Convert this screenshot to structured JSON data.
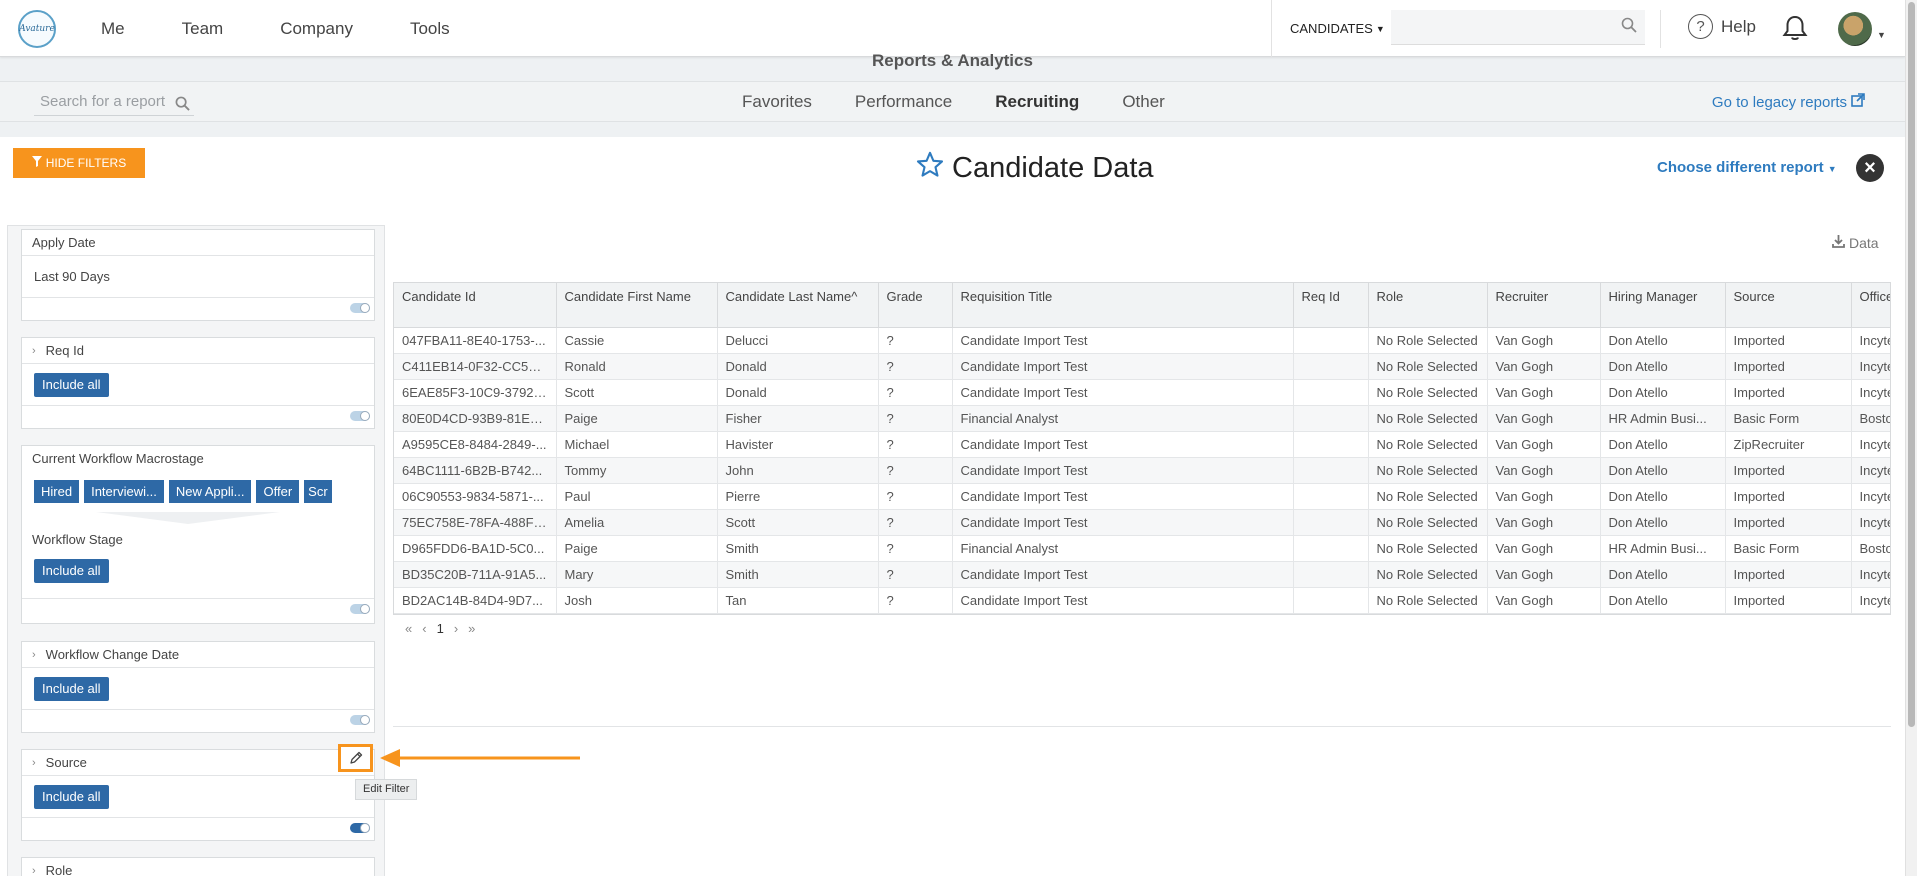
{
  "topnav": {
    "logo_text": "Avature",
    "links": [
      "Me",
      "Team",
      "Company",
      "Tools"
    ],
    "candidates_label": "CANDIDATES",
    "help_label": "Help"
  },
  "reports": {
    "title": "Reports & Analytics",
    "search_placeholder": "Search for a report",
    "tabs": [
      "Favorites",
      "Performance",
      "Recruiting",
      "Other"
    ],
    "active_tab": "Recruiting",
    "legacy_label": "Go to legacy reports"
  },
  "report": {
    "hide_filters_label": "HIDE FILTERS",
    "title": "Candidate Data",
    "choose_label": "Choose different report",
    "export_label": "Data"
  },
  "filters": {
    "apply_date": {
      "label": "Apply Date",
      "value": "Last 90 Days"
    },
    "req_id": {
      "label": "Req Id",
      "button": "Include all"
    },
    "macrostage": {
      "label": "Current Workflow Macrostage",
      "chips": [
        "Hired",
        "Interviewi...",
        "New Appli...",
        "Offer",
        "Scr"
      ],
      "stage_label": "Workflow Stage",
      "stage_button": "Include all"
    },
    "workflow_change_date": {
      "label": "Workflow Change Date",
      "button": "Include all"
    },
    "source": {
      "label": "Source",
      "button": "Include all",
      "edit_tooltip": "Edit Filter"
    },
    "role": {
      "label": "Role"
    }
  },
  "table": {
    "columns": [
      "Candidate Id",
      "Candidate First Name",
      "Candidate Last Name",
      "Grade",
      "Requisition Title",
      "Req Id",
      "Role",
      "Recruiter",
      "Hiring Manager",
      "Source",
      "Office"
    ],
    "sorted_indicator": "^",
    "rows": [
      [
        "047FBA11-8E40-1753-...",
        "Cassie",
        "Delucci",
        "?",
        "Candidate Import Test",
        "",
        "No Role Selected",
        "Van Gogh",
        "Don Atello",
        "Imported",
        "Incyte"
      ],
      [
        "C411EB14-0F32-CC59-...",
        "Ronald",
        "Donald",
        "?",
        "Candidate Import Test",
        "",
        "No Role Selected",
        "Van Gogh",
        "Don Atello",
        "Imported",
        "Incyte"
      ],
      [
        "6EAE85F3-10C9-3792-...",
        "Scott",
        "Donald",
        "?",
        "Candidate Import Test",
        "",
        "No Role Selected",
        "Van Gogh",
        "Don Atello",
        "Imported",
        "Incyte"
      ],
      [
        "80E0D4CD-93B9-81E9...",
        "Paige",
        "Fisher",
        "?",
        "Financial Analyst",
        "",
        "No Role Selected",
        "Van Gogh",
        "HR Admin Busi...",
        "Basic Form",
        "Boston"
      ],
      [
        "A9595CE8-8484-2849-...",
        "Michael",
        "Havister",
        "?",
        "Candidate Import Test",
        "",
        "No Role Selected",
        "Van Gogh",
        "Don Atello",
        "ZipRecruiter",
        "Incyte"
      ],
      [
        "64BC1111-6B2B-B742...",
        "Tommy",
        "John",
        "?",
        "Candidate Import Test",
        "",
        "No Role Selected",
        "Van Gogh",
        "Don Atello",
        "Imported",
        "Incyte"
      ],
      [
        "06C90553-9834-5871-...",
        "Paul",
        "Pierre",
        "?",
        "Candidate Import Test",
        "",
        "No Role Selected",
        "Van Gogh",
        "Don Atello",
        "Imported",
        "Incyte"
      ],
      [
        "75EC758E-78FA-488F-...",
        "Amelia",
        "Scott",
        "?",
        "Candidate Import Test",
        "",
        "No Role Selected",
        "Van Gogh",
        "Don Atello",
        "Imported",
        "Incyte"
      ],
      [
        "D965FDD6-BA1D-5C0...",
        "Paige",
        "Smith",
        "?",
        "Financial Analyst",
        "",
        "No Role Selected",
        "Van Gogh",
        "HR Admin Busi...",
        "Basic Form",
        "Boston"
      ],
      [
        "BD35C20B-711A-91A5...",
        "Mary",
        "Smith",
        "?",
        "Candidate Import Test",
        "",
        "No Role Selected",
        "Van Gogh",
        "Don Atello",
        "Imported",
        "Incyte"
      ],
      [
        "BD2AC14B-84D4-9D7...",
        "Josh",
        "Tan",
        "?",
        "Candidate Import Test",
        "",
        "No Role Selected",
        "Van Gogh",
        "Don Atello",
        "Imported",
        "Incyte"
      ]
    ],
    "pager": {
      "first": "«",
      "prev": "‹",
      "page": "1",
      "next": "›",
      "last": "»"
    }
  },
  "colors": {
    "accent_orange": "#f7941d",
    "primary_blue": "#2e69a6",
    "link_blue": "#2e7bbf"
  }
}
